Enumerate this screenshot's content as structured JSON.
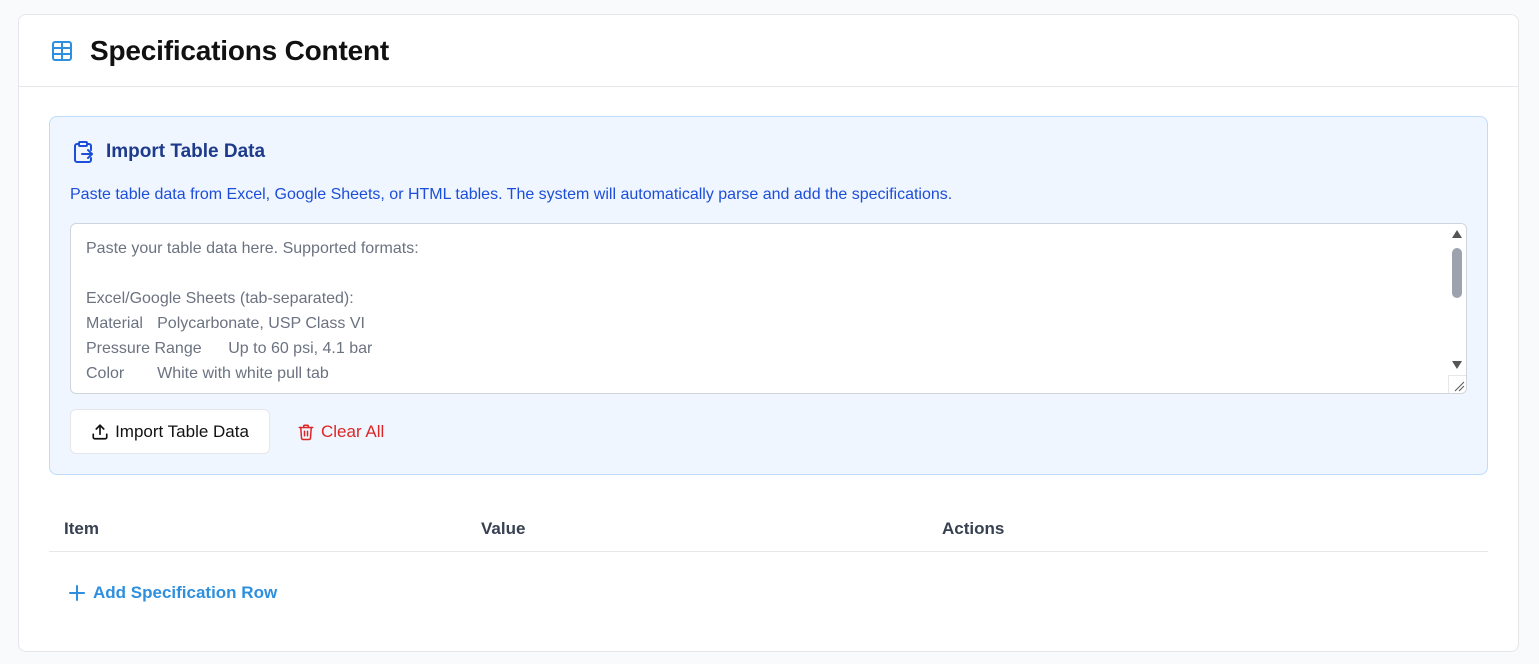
{
  "card": {
    "title": "Specifications Content",
    "title_icon": "table-icon"
  },
  "import": {
    "title": "Import Table Data",
    "title_icon": "clipboard-import-icon",
    "description": "Paste table data from Excel, Google Sheets, or HTML tables. The system will automatically parse and add the specifications.",
    "placeholder": "Paste your table data here. Supported formats:\n\nExcel/Google Sheets (tab-separated):\nMaterial\tPolycarbonate, USP Class VI\nPressure Range\tUp to 60 psi, 4.1 bar\nColor\tWhite with white pull tab",
    "import_button_label": "Import Table Data",
    "import_button_icon": "upload-icon",
    "clear_button_label": "Clear All",
    "clear_button_icon": "trash-icon"
  },
  "table": {
    "columns": [
      "Item",
      "Value",
      "Actions"
    ]
  },
  "add_row": {
    "label": "Add Specification Row",
    "icon": "plus-icon"
  },
  "colors": {
    "accent": "#2e8fdf",
    "import_bg": "#eff6ff",
    "import_title": "#1e3a8a",
    "import_desc": "#1d4ed8",
    "danger": "#dc2626"
  }
}
